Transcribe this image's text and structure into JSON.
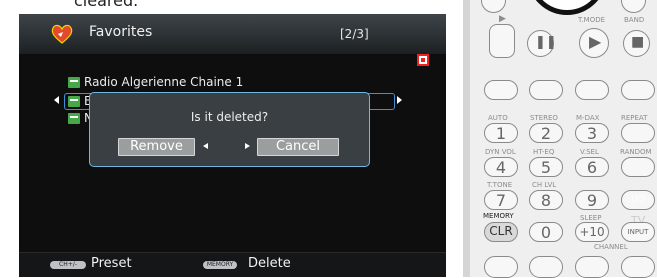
{
  "page": {
    "top_text": "cleared."
  },
  "tv": {
    "title": "Favorites",
    "page_indicator": "[2/3]",
    "list": [
      {
        "label": "Radio Algerienne Chaine 1"
      },
      {
        "label": "E"
      },
      {
        "label": "N"
      }
    ],
    "dialog": {
      "message": "Is it deleted?",
      "remove_label": "Remove",
      "cancel_label": "Cancel"
    },
    "footer": {
      "ch_key": "CH+/-",
      "preset_label": "Preset",
      "memory_key": "MEMORY",
      "delete_label": "Delete"
    }
  },
  "remote": {
    "top_labels": [
      "T.MODE",
      "BAND"
    ],
    "row_labels_1": [
      "AUTO",
      "STEREO",
      "M-DAX",
      "REPEAT"
    ],
    "row_labels_2": [
      "DYN VOL",
      "HT-EQ",
      "V.SEL",
      "RANDOM"
    ],
    "row_labels_3": [
      "T.TONE",
      "CH LVL"
    ],
    "row_labels_4": [
      "MEMORY",
      "SLEEP",
      "TV"
    ],
    "numbers": [
      "1",
      "2",
      "3",
      "4",
      "5",
      "6",
      "7",
      "8",
      "9",
      "0",
      "+10"
    ],
    "clr": "CLR",
    "input": "INPUT",
    "channel": "CHANNEL",
    "power": "I/⏻"
  },
  "colors": {
    "dialog_border": "#6fb8e0",
    "selection": "#3f8fd8",
    "red_marker": "#e22222",
    "list_icon": "#47a84a"
  }
}
